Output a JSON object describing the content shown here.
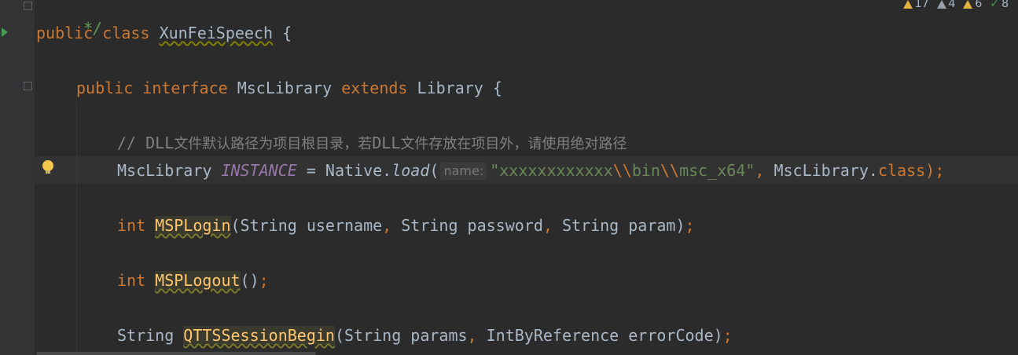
{
  "status_bar": {
    "warnings_count": "17",
    "weak_warnings_count": "4",
    "typos_count": "6",
    "ok_count": "8"
  },
  "code": {
    "line0": {
      "text": "*/"
    },
    "line1": {
      "kw1": "public",
      "kw2": "class",
      "classname": "XunFeiSpeech",
      "brace": " {"
    },
    "line2": {
      "kw1": "public",
      "kw2": "interface",
      "name": "MscLibrary",
      "kw3": "extends",
      "parent": "Library",
      "brace": " {"
    },
    "line3": {
      "comment_prefix": "// DLL",
      "comment_cn": "文件默认路径为项目根目录，若",
      "comment_mid": "DLL",
      "comment_cn2": "文件存放在项目外，请使用绝对路径"
    },
    "line4": {
      "type": "MscLibrary",
      "const": "INSTANCE",
      "eq": " = Native.",
      "method": "load",
      "paren": "(",
      "hint": "name:",
      "str1": "\"xxxxxxxxxxxx",
      "esc1": "\\\\",
      "str2": "bin",
      "esc2": "\\\\",
      "str3": "msc_x64\"",
      "comma": ",",
      "rest1": " MscLibrary.",
      "kwclass": "class",
      "end": ");"
    },
    "line5": {
      "kw": "int",
      "method": "MSPLogin",
      "args1": "(String username",
      "c1": ",",
      "args2": " String password",
      "c2": ",",
      "args3": " String param)",
      "semi": ";"
    },
    "line6": {
      "kw": "int",
      "method": "MSPLogout",
      "args": "()",
      "semi": ";"
    },
    "line7": {
      "type": "String",
      "method": "QTTSSessionBegin",
      "args1": "(String params",
      "c1": ",",
      "args2": " IntByReference errorCode)",
      "semi": ";"
    }
  }
}
